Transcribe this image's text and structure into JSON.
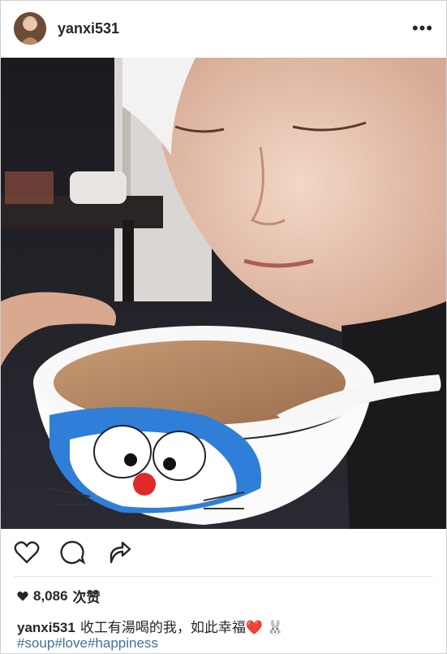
{
  "post": {
    "username": "yanxi531",
    "more_label": "•••",
    "likes_count": "8,086",
    "likes_suffix": "次赞",
    "caption_username": "yanxi531",
    "caption_text": "收工有湯喝的我，如此幸福",
    "caption_emoji_heart": "❤️",
    "caption_emoji_bunny": "🐰",
    "hashtags": "#soup#love#happiness"
  },
  "icons": {
    "like": "heart-outline-icon",
    "comment": "speech-bubble-icon",
    "share": "share-arrow-icon",
    "likes_marker": "filled-heart-icon",
    "menu": "more-dots-icon"
  },
  "colors": {
    "text": "#262626",
    "hashtag": "#3f729b",
    "heart": "#e0245e",
    "doraemon_blue": "#2f7ed8"
  }
}
